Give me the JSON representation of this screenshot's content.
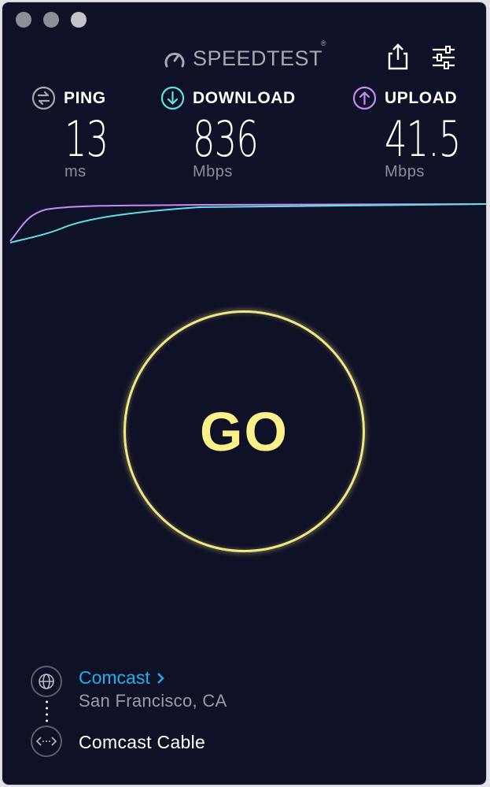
{
  "app": {
    "logo_text": "SPEEDTEST",
    "trademark": "®"
  },
  "metrics": {
    "ping": {
      "label": "PING",
      "value": "13",
      "unit": "ms",
      "icon": "ping-icon",
      "color": "#a6a8b3"
    },
    "download": {
      "label": "DOWNLOAD",
      "value": "836",
      "unit": "Mbps",
      "icon": "download-arrow-icon",
      "color": "#5fe0e6"
    },
    "upload": {
      "label": "UPLOAD",
      "value": "41.5",
      "unit": "Mbps",
      "icon": "upload-arrow-icon",
      "color": "#c48cf5"
    }
  },
  "go_button": {
    "label": "GO",
    "color": "#f2e883"
  },
  "server": {
    "isp": "Comcast",
    "location": "San Francisco, CA",
    "host": "Comcast Cable"
  },
  "colors": {
    "background": "#0f1226",
    "isp_link": "#1fb0f0"
  }
}
